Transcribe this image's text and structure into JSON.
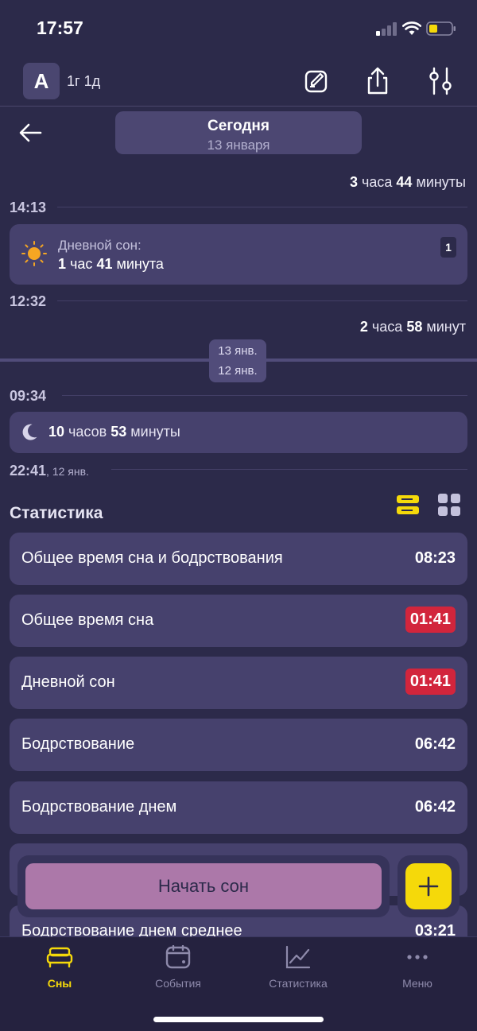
{
  "status_bar": {
    "time": "17:57"
  },
  "header": {
    "avatar_letter": "A",
    "child_age": "1г 1д",
    "icons": [
      "edit-icon",
      "share-icon",
      "filters-icon"
    ]
  },
  "date_selector": {
    "title": "Сегодня",
    "subtitle": "13 января"
  },
  "timeline": {
    "wake_1": {
      "num1": "3",
      "unit1": "часа",
      "num2": "44",
      "unit2": "минуты"
    },
    "mark_1": "14:13",
    "nap": {
      "label": "Дневной сон:",
      "hours": "1",
      "hours_unit": "час",
      "minutes": "41",
      "minutes_unit": "минута",
      "badge": "1"
    },
    "mark_2": "12:32",
    "wake_2": {
      "num1": "2",
      "unit1": "часа",
      "num2": "58",
      "unit2": "минут"
    },
    "day_chip": {
      "upper": "13 янв.",
      "lower": "12 янв."
    },
    "mark_3": "09:34",
    "night": {
      "hours": "10",
      "hours_unit": "часов",
      "minutes": "53",
      "minutes_unit": "минуты"
    },
    "mark_4": "22:41",
    "mark_4_date": ", 12 янв."
  },
  "statistics": {
    "title": "Статистика",
    "rows": [
      {
        "label": "Общее время сна и бодрствования",
        "value": "08:23",
        "alert": false
      },
      {
        "label": "Общее время сна",
        "value": "01:41",
        "alert": true
      },
      {
        "label": "Дневной сон",
        "value": "01:41",
        "alert": true
      },
      {
        "label": "Бодрствование",
        "value": "06:42",
        "alert": false
      },
      {
        "label": "Бодрствование днем",
        "value": "06:42",
        "alert": false
      },
      {
        "label": "",
        "value": "",
        "alert": false
      },
      {
        "label": "Бодрствование днем среднее",
        "value": "03:21",
        "alert": false
      }
    ]
  },
  "actions": {
    "start_sleep": "Начать сон"
  },
  "tabbar": {
    "tabs": [
      {
        "label": "Сны",
        "icon": "bed-icon",
        "active": true
      },
      {
        "label": "События",
        "icon": "calendar-icon",
        "active": false
      },
      {
        "label": "Статистика",
        "icon": "chart-icon",
        "active": false
      },
      {
        "label": "Меню",
        "icon": "more-icon",
        "active": false
      }
    ]
  },
  "colors": {
    "background": "#2c2a4a",
    "card": "#46416d",
    "accent_yellow": "#f5d90a",
    "alert_red": "#d2253c",
    "start_button": "#ac78a9"
  }
}
